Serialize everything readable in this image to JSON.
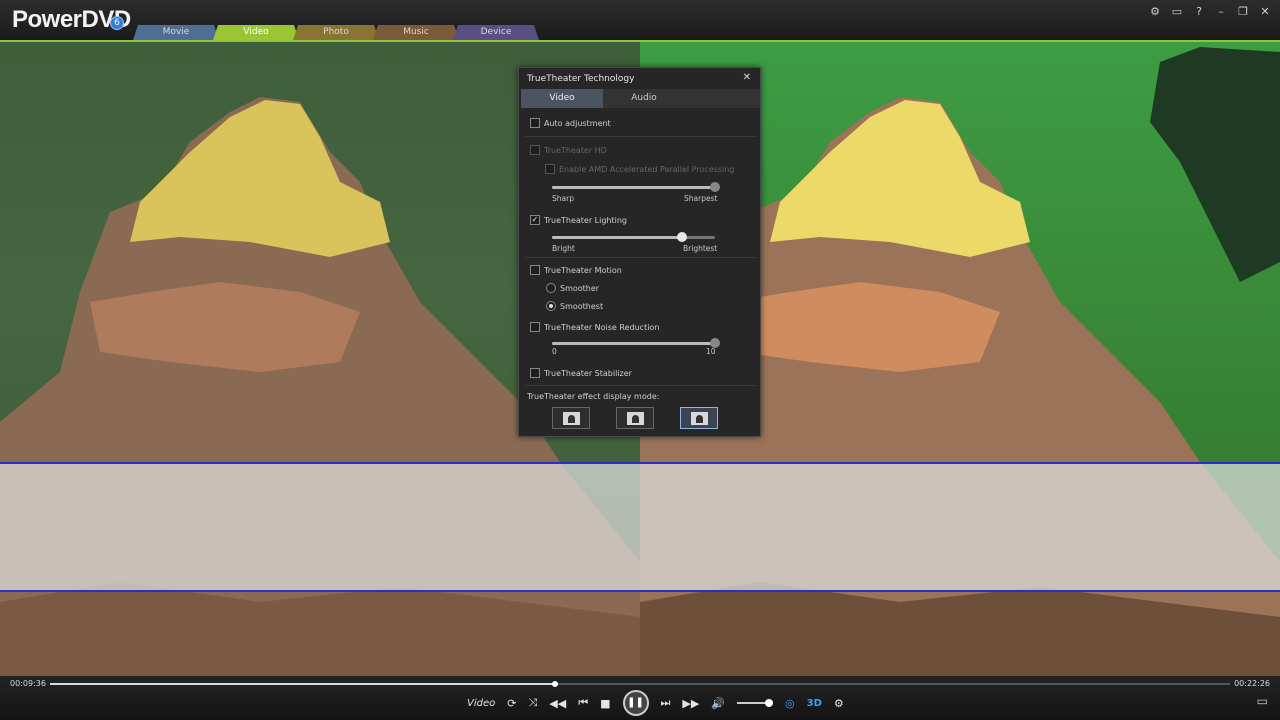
{
  "app": {
    "name_main": "PowerDVD",
    "badge": "6"
  },
  "tabs": [
    {
      "label": "Movie"
    },
    {
      "label": "Video"
    },
    {
      "label": "Photo"
    },
    {
      "label": "Music"
    },
    {
      "label": "Device"
    }
  ],
  "window_icons": [
    "gear-icon",
    "tv-icon",
    "help-icon",
    "minimize-icon",
    "restore-icon",
    "close-icon"
  ],
  "window_icon_glyphs": {
    "settings": "⚙",
    "tv": "▭",
    "help": "?",
    "minimize": "–",
    "restore": "❐",
    "close": "✕"
  },
  "dialog": {
    "title": "TrueTheater Technology",
    "close": "✕",
    "tabs": {
      "video": "Video",
      "audio": "Audio"
    },
    "auto_adjustment": {
      "label": "Auto adjustment",
      "checked": false
    },
    "hd": {
      "label": "TrueTheater HD",
      "checked": false,
      "enabled": false
    },
    "amd": {
      "label": "Enable AMD Accelerated Parallel Processing",
      "checked": false,
      "enabled": false
    },
    "hd_slider": {
      "min_label": "Sharp",
      "max_label": "Sharpest",
      "value": 1.0
    },
    "lighting": {
      "label": "TrueTheater Lighting",
      "checked": true
    },
    "lighting_slider": {
      "min_label": "Bright",
      "max_label": "Brightest",
      "value": 0.8
    },
    "motion": {
      "label": "TrueTheater Motion",
      "checked": false
    },
    "motion_options": [
      {
        "label": "Smoother",
        "selected": false
      },
      {
        "label": "Smoothest",
        "selected": true
      }
    ],
    "noise": {
      "label": "TrueTheater Noise Reduction",
      "checked": false
    },
    "noise_slider": {
      "min_label": "0",
      "max_label": "10",
      "value": 1.0
    },
    "stabilizer": {
      "label": "TrueTheater Stabilizer",
      "checked": false
    },
    "display_mode_label": "TrueTheater effect display mode:",
    "display_modes": [
      "full-icon",
      "split-icon",
      "side-by-side-icon"
    ],
    "selected_display_mode": "side-by-side-icon",
    "checkmark": "✓"
  },
  "player": {
    "current_time": "00:09:36",
    "total_time": "00:22:26",
    "progress": 0.428,
    "mode_label": "Video",
    "volume": 0.9,
    "glyphs": {
      "repeat": "⟳",
      "shuffle": "⤨",
      "prev_chapter": "◀◀",
      "prev": "⏮",
      "stop": "■",
      "play_pause": "❚❚",
      "next": "⏭",
      "next_chapter": "▶▶",
      "volume": "🔊",
      "truetheater": "◎",
      "3d": "3D",
      "3d_settings": "⚙",
      "mini": "▭"
    }
  }
}
